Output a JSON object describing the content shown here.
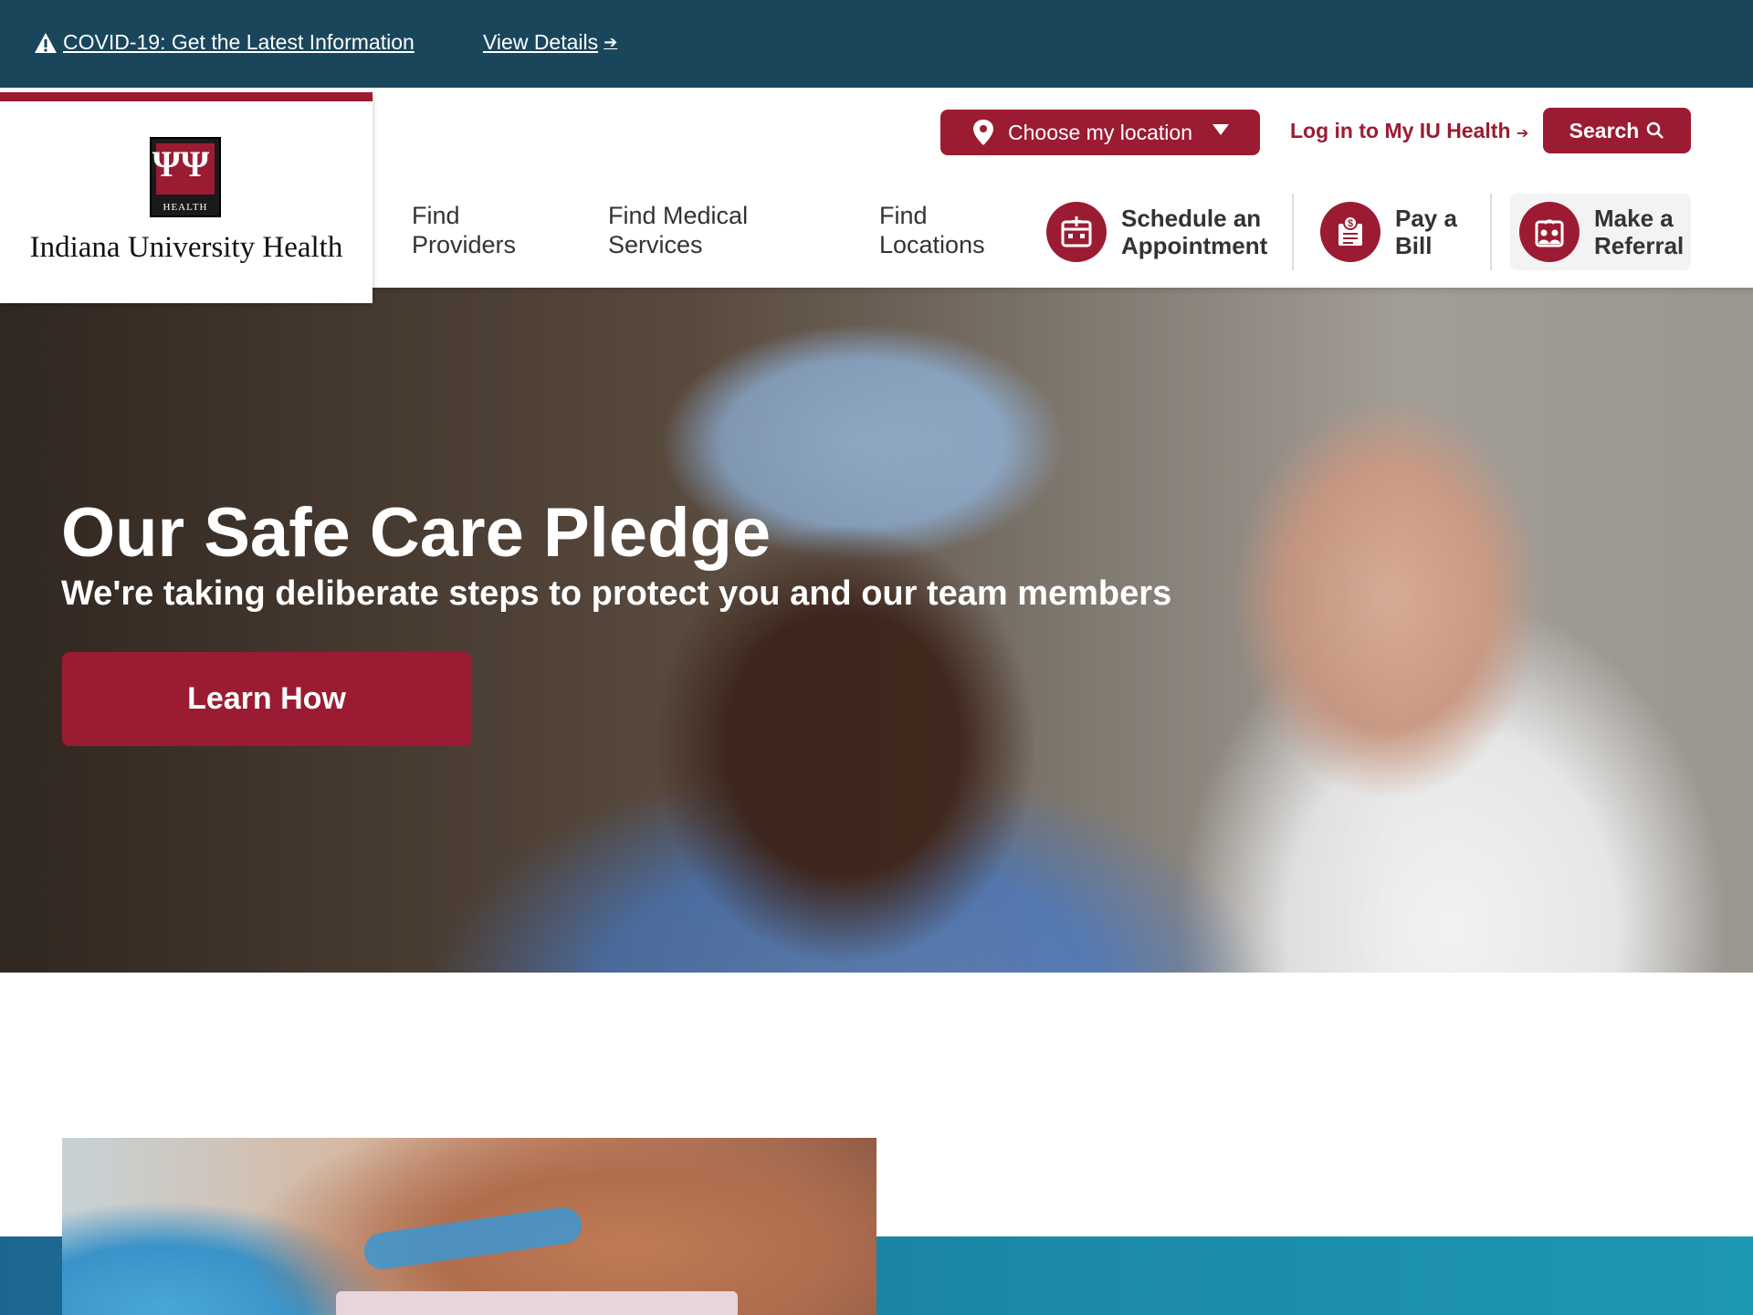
{
  "alert": {
    "covid_label": "COVID-19: Get the Latest Information",
    "details_label": "View Details",
    "icon": "warning-icon"
  },
  "logo": {
    "health_tag": "HEALTH",
    "text": "Indiana University Health"
  },
  "utility": {
    "location_label": "Choose my location",
    "login_label": "Log in to My IU Health",
    "search_label": "Search"
  },
  "nav": {
    "items": [
      {
        "line1": "Find",
        "line2": "Providers"
      },
      {
        "line1": "Find Medical",
        "line2": "Services"
      },
      {
        "line1": "Find",
        "line2": "Locations"
      }
    ]
  },
  "actions": {
    "schedule": {
      "line1": "Schedule an",
      "line2": "Appointment",
      "icon": "calendar-plus-icon"
    },
    "pay": {
      "line1": "Pay a",
      "line2": "Bill",
      "icon": "bill-icon"
    },
    "referral": {
      "line1": "Make a",
      "line2": "Referral",
      "icon": "referral-icon"
    }
  },
  "hero": {
    "title": "Our Safe Care Pledge",
    "subtitle": "We're taking deliberate steps to protect you and our team members",
    "cta_label": "Learn How"
  },
  "colors": {
    "brand_red": "#9b1c32",
    "alert_bg": "#1a465c",
    "teal_band": "#1b8aa8"
  }
}
